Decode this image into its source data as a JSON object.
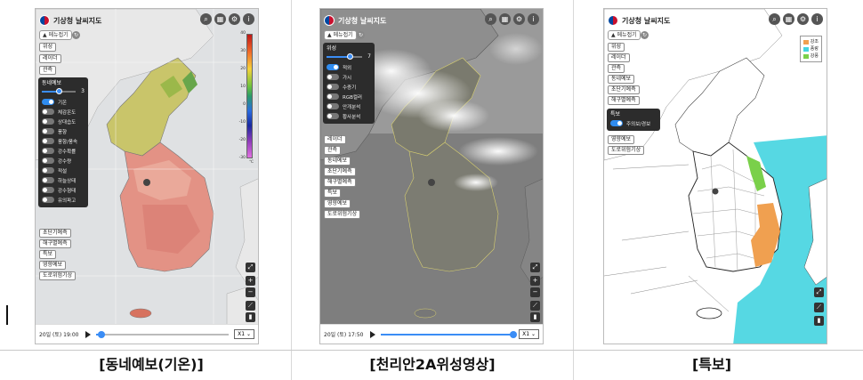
{
  "app": {
    "title": "기상청 날씨지도",
    "menu_label": "메뉴접기"
  },
  "panels": [
    {
      "id": "forecast",
      "caption": "[동네예보(기온)]",
      "chips_top": [
        "위성",
        "레이더",
        "관측"
      ],
      "dpanel_title": "동네예보",
      "slider_value": "3",
      "toggles": [
        {
          "label": "기온",
          "on": true
        },
        {
          "label": "체감온도",
          "on": false
        },
        {
          "label": "상대습도",
          "on": false
        },
        {
          "label": "풍향",
          "on": false
        },
        {
          "label": "풍향/풍속",
          "on": false
        },
        {
          "label": "강수확률",
          "on": false
        },
        {
          "label": "강수량",
          "on": false
        },
        {
          "label": "적설",
          "on": false
        },
        {
          "label": "하늘상태",
          "on": false
        },
        {
          "label": "강수형태",
          "on": false
        },
        {
          "label": "유의파고",
          "on": false
        }
      ],
      "chips_bottom": [
        "초단기예측",
        "해구별예측",
        "특보",
        "영향예보",
        "도로위험기상"
      ],
      "legend_ticks": [
        "40",
        "30",
        "20",
        "10",
        "0",
        "-10",
        "-20",
        "-30"
      ],
      "legend_unit": "℃",
      "time": "20일 (토) 19:00",
      "speed": "X1",
      "progress": 0.04
    },
    {
      "id": "satellite",
      "caption": "[천리안2A위성영상]",
      "dpanel_title": "위성",
      "slider_value": "7",
      "toggles": [
        {
          "label": "적외",
          "on": true
        },
        {
          "label": "가시",
          "on": false
        },
        {
          "label": "수증기",
          "on": false
        },
        {
          "label": "RGB컬러",
          "on": false
        },
        {
          "label": "안개분석",
          "on": false
        },
        {
          "label": "황사분석",
          "on": false
        }
      ],
      "chips_bottom": [
        "레이더",
        "관측",
        "동네예보",
        "초단기예측",
        "해구별예측",
        "특보",
        "영향예보",
        "도로위험기상"
      ],
      "time": "20일 (토) 17:50",
      "speed": "X1",
      "progress": 1.0
    },
    {
      "id": "warning",
      "caption": "[특보]",
      "chips_top": [
        "위성",
        "레이더",
        "관측",
        "동네예보",
        "초단기예측",
        "해구별예측"
      ],
      "dpanel_title": "특보",
      "toggles": [
        {
          "label": "주의보/경보",
          "on": true
        }
      ],
      "chips_bottom": [
        "영향예보",
        "도로위험기상"
      ],
      "legend": [
        {
          "label": "강조",
          "color": "#f0a050"
        },
        {
          "label": "풍랑",
          "color": "#44d4e0"
        },
        {
          "label": "강풍",
          "color": "#7ad04a"
        }
      ]
    }
  ],
  "colors": {
    "sea_gray": "#d9dde0",
    "accent": "#3b8df5",
    "warning_sea": "#44d4e0"
  }
}
